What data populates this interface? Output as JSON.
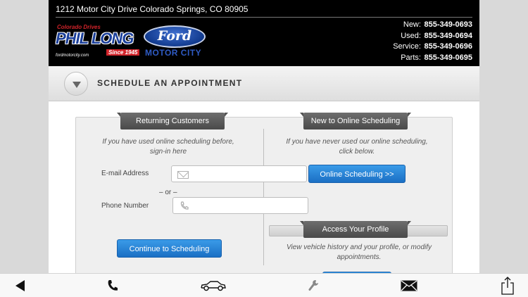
{
  "header": {
    "address": "1212 Motor City Drive  Colorado Springs,  CO  80905",
    "logo": {
      "tagline": "Colorado Drives",
      "name": "PHIL LONG",
      "since": "Since 1945",
      "url": "fordmotorcity.com",
      "brand": "Ford",
      "subbrand": "MOTOR CITY"
    },
    "phones": [
      {
        "label": "New:",
        "number": "855-349-0693"
      },
      {
        "label": "Used:",
        "number": "855-349-0694"
      },
      {
        "label": "Service:",
        "number": "855-349-0696"
      },
      {
        "label": "Parts:",
        "number": "855-349-0695"
      }
    ]
  },
  "schedule": {
    "title": "SCHEDULE AN APPOINTMENT",
    "returning": {
      "tab": "Returning Customers",
      "note_line1": "If you have used online scheduling before,",
      "note_line2": "sign-in here",
      "email_label": "E-mail Address",
      "or_text": "– or –",
      "phone_label": "Phone Number",
      "email_value": "",
      "phone_value": "",
      "continue_button": "Continue to Scheduling"
    },
    "new": {
      "tab": "New to Online Scheduling",
      "note_line1": "If you have never used our online scheduling,",
      "note_line2": "click below.",
      "online_button": "Online Scheduling >>"
    },
    "profile": {
      "tab": "Access Your Profile",
      "note_line1": "View vehicle history and your profile, or modify",
      "note_line2": "appointments."
    }
  },
  "toolbar": {
    "items": [
      "back-icon",
      "phone-icon",
      "car-icon",
      "wrench-icon",
      "mail-icon",
      "share-icon"
    ]
  },
  "colors": {
    "button_blue": "#1b6fc4",
    "tab_gray": "#555555",
    "header_bg": "#000000"
  }
}
